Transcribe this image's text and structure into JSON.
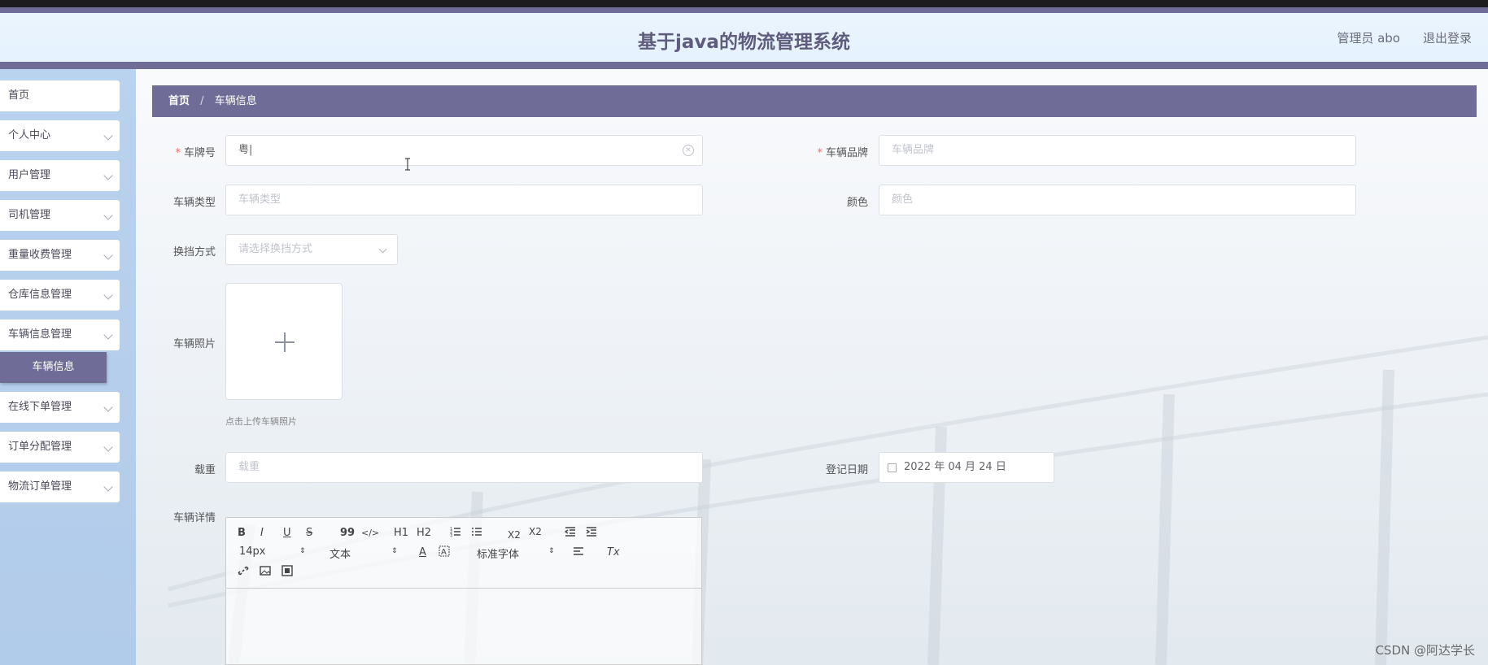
{
  "header": {
    "title": "基于java的物流管理系统",
    "user": "管理员 abo",
    "logout": "退出登录"
  },
  "sidebar": {
    "items": [
      {
        "label": "首页"
      },
      {
        "label": "个人中心"
      },
      {
        "label": "用户管理"
      },
      {
        "label": "司机管理"
      },
      {
        "label": "重量收费管理"
      },
      {
        "label": "仓库信息管理"
      },
      {
        "label": "车辆信息管理"
      },
      {
        "label": "在线下单管理"
      },
      {
        "label": "订单分配管理"
      },
      {
        "label": "物流订单管理"
      }
    ],
    "active_sub": "车辆信息"
  },
  "breadcrumb": {
    "home": "首页",
    "separator": "/",
    "current": "车辆信息"
  },
  "form": {
    "plate_label": "车牌号",
    "plate_value": "粤|",
    "brand_label": "车辆品牌",
    "brand_placeholder": "车辆品牌",
    "type_label": "车辆类型",
    "type_placeholder": "车辆类型",
    "color_label": "颜色",
    "color_placeholder": "颜色",
    "gear_label": "换挡方式",
    "gear_placeholder": "请选择换挡方式",
    "photo_label": "车辆照片",
    "photo_tip": "点击上传车辆照片",
    "load_label": "载重",
    "load_placeholder": "载重",
    "date_label": "登记日期",
    "date_value": "2022 年 04 月 24 日",
    "detail_label": "车辆详情"
  },
  "editor": {
    "bold": "B",
    "italic": "I",
    "underline": "U",
    "strike": "S",
    "quote": "99",
    "code": "</>",
    "h1": "H1",
    "h2": "H2",
    "sub": "X2",
    "sup": "X2",
    "font_size": "14px",
    "text_type": "文本",
    "color": "A",
    "font_family": "标准字体",
    "clear": "Tx"
  },
  "watermark": "CSDN @阿达学长",
  "colors": {
    "accent": "#6f6d97",
    "header_bg": "#e7f3fd",
    "sidebar_bg": "#b5ceec",
    "required": "#f56c6c"
  }
}
